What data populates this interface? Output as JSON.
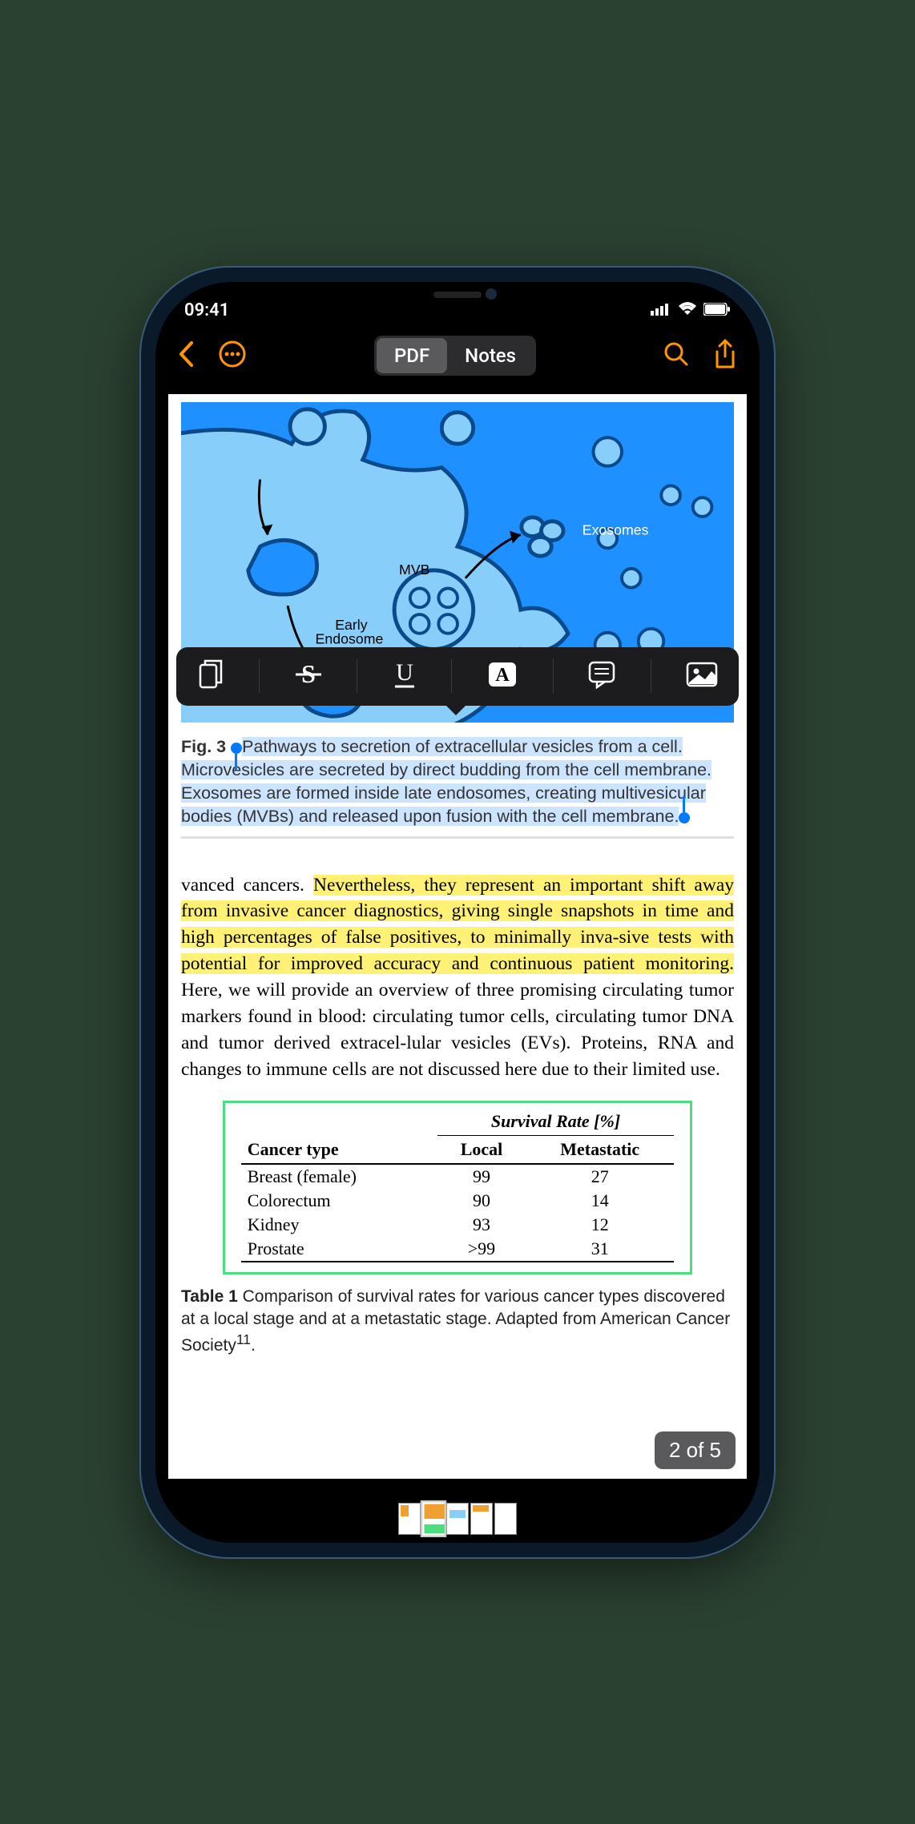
{
  "status": {
    "time": "09:41"
  },
  "toolbar": {
    "segments": {
      "pdf": "PDF",
      "notes": "Notes"
    }
  },
  "context_menu": {
    "items": [
      "copy",
      "strikethrough",
      "underline",
      "highlight-box",
      "comment",
      "image"
    ]
  },
  "figure": {
    "label_prefix": "Fig.  3 ",
    "caption": "Pathways to secretion of extracellular vesicles from a cell. Microvesicles are secreted by direct budding from the cell membrane. Exosomes are formed inside late endosomes, creating multivesicular bodies (MVBs) and released upon fusion with the cell membrane.",
    "diagram_labels": {
      "mvb": "MVB",
      "early_endosome_l1": "Early",
      "early_endosome_l2": "Endosome",
      "exosomes": "Exosomes"
    }
  },
  "body": {
    "pretext": "vanced cancers.  ",
    "highlighted": "Nevertheless, they represent an important shift away from invasive cancer diagnostics, giving single snapshots in time and high percentages of false positives, to minimally inva-sive tests with potential for improved accuracy and continuous patient monitoring.",
    "posttext": "  Here, we will provide an overview of three promising circulating tumor markers found in blood: circulating tumor cells, circulating tumor DNA and tumor derived extracel-lular vesicles (EVs).  Proteins, RNA and changes to immune cells are not discussed here due to their limited use."
  },
  "table": {
    "header1": "Cancer type",
    "header2": "Survival Rate [%]",
    "sub1": "Local",
    "sub2": "Metastatic",
    "rows": [
      {
        "type": "Breast (female)",
        "local": "99",
        "meta": "27"
      },
      {
        "type": "Colorectum",
        "local": "90",
        "meta": "14"
      },
      {
        "type": "Kidney",
        "local": "93",
        "meta": "12"
      },
      {
        "type": "Prostate",
        "local": ">99",
        "meta": "31"
      }
    ],
    "caption_label": "Table 1 ",
    "caption": "Comparison of survival rates for various cancer types discovered at a local stage and at a metastatic stage. Adapted from American Cancer Society",
    "caption_sup": "11",
    "caption_end": "."
  },
  "pager": {
    "label": "2 of 5"
  },
  "chart_data": {
    "type": "table",
    "title": "Survival Rate [%]",
    "columns": [
      "Cancer type",
      "Local",
      "Metastatic"
    ],
    "rows": [
      [
        "Breast (female)",
        99,
        27
      ],
      [
        "Colorectum",
        90,
        14
      ],
      [
        "Kidney",
        93,
        12
      ],
      [
        "Prostate",
        ">99",
        31
      ]
    ]
  }
}
